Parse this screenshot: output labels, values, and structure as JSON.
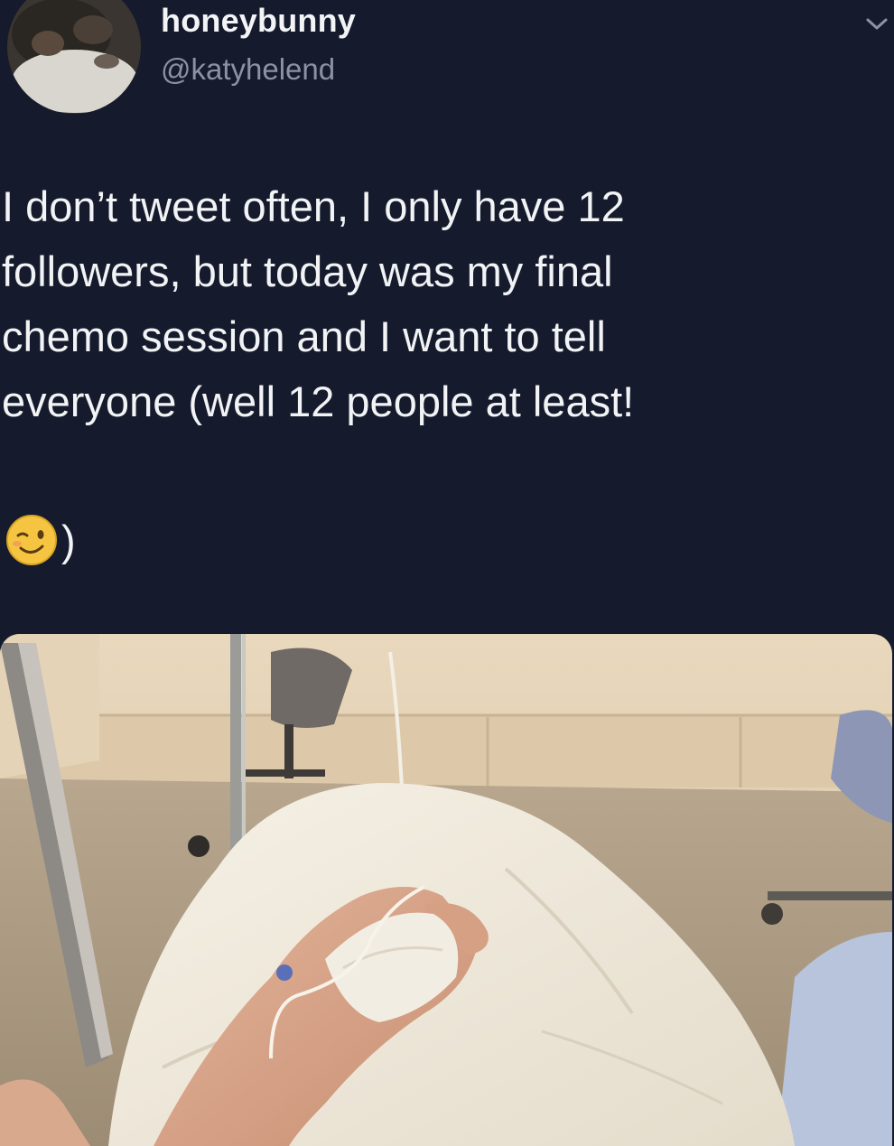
{
  "tweet": {
    "display_name": "honeybunny",
    "handle": "@katyhelend",
    "text": "I don’t tweet often, I only have 12\nfollowers, but today was my final\nchemo session and I want to tell\neveryone (well 12 people at least!",
    "closing_paren": ")",
    "emoji_icon": "winking-face-emoji",
    "menu_icon": "chevron-down-icon",
    "media_icon": "hospital-photo-hand-with-iv"
  },
  "colors": {
    "background": "#151b2d",
    "name": "#f3f4f6",
    "handle": "#8b93a3",
    "text": "#f2f3f5"
  }
}
